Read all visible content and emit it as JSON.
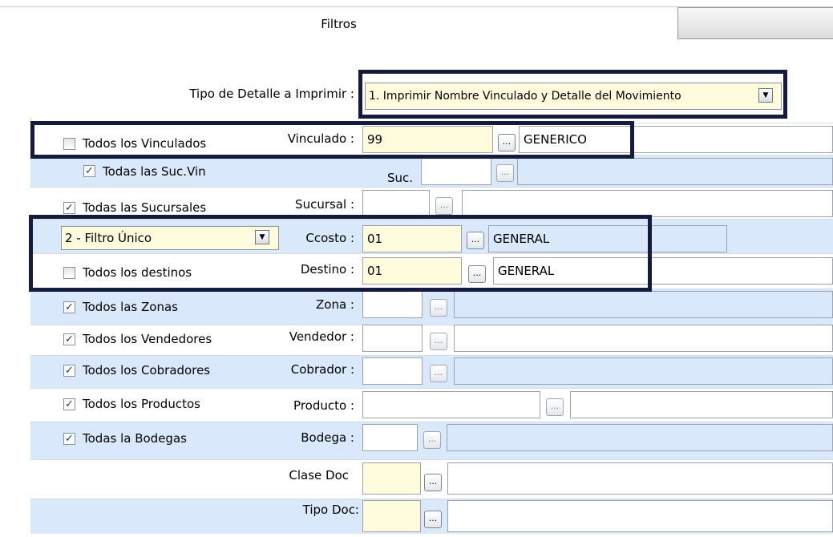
{
  "tabs": {
    "active": "Filtros",
    "inactive": ""
  },
  "tipo_detalle": {
    "label": "Tipo de Detalle a  Imprimir :",
    "value": "1. Imprimir Nombre Vinculado y Detalle del Movimiento"
  },
  "rows": {
    "vinculados": {
      "check_label": "Todos los Vinculados",
      "checked": false,
      "field_label": "Vinculado :",
      "code": "99",
      "name": "GENERICO"
    },
    "suc_vin": {
      "check_label": "Todas las Suc.Vin",
      "checked": true,
      "field_label": "Suc.",
      "code": "",
      "name": ""
    },
    "sucursales": {
      "check_label": "Todas las Sucursales",
      "checked": true,
      "field_label": "Sucursal :",
      "code": "",
      "name": ""
    },
    "ccosto": {
      "filter_value": "2 - Filtro Único",
      "field_label": "Ccosto :",
      "code": "01",
      "name": "GENERAL"
    },
    "destinos": {
      "check_label": "Todos los destinos",
      "checked": false,
      "field_label": "Destino :",
      "code": "01",
      "name": "GENERAL"
    },
    "zonas": {
      "check_label": "Todos las Zonas",
      "checked": true,
      "field_label": "Zona :",
      "code": "",
      "name": ""
    },
    "vendedores": {
      "check_label": "Todos los Vendedores",
      "checked": true,
      "field_label": "Vendedor :",
      "code": "",
      "name": ""
    },
    "cobradores": {
      "check_label": "Todos los Cobradores",
      "checked": true,
      "field_label": "Cobrador :",
      "code": "",
      "name": ""
    },
    "productos": {
      "check_label": "Todos los Productos",
      "checked": true,
      "field_label": "Producto :",
      "code": "",
      "name": ""
    },
    "bodegas": {
      "check_label": "Todas la Bodegas",
      "checked": true,
      "field_label": "Bodega :",
      "code": "",
      "name": ""
    },
    "clase_doc": {
      "field_label": "Clase Doc",
      "code": "",
      "name": ""
    },
    "tipo_doc": {
      "field_label": "Tipo Doc:",
      "code": "",
      "name": ""
    }
  },
  "lookup_button_label": "...",
  "check_mark": "✓",
  "colors": {
    "highlight_frame": "#151b3f",
    "row_blue": "#d9e8fb",
    "input_yellow": "#fffbdc"
  }
}
